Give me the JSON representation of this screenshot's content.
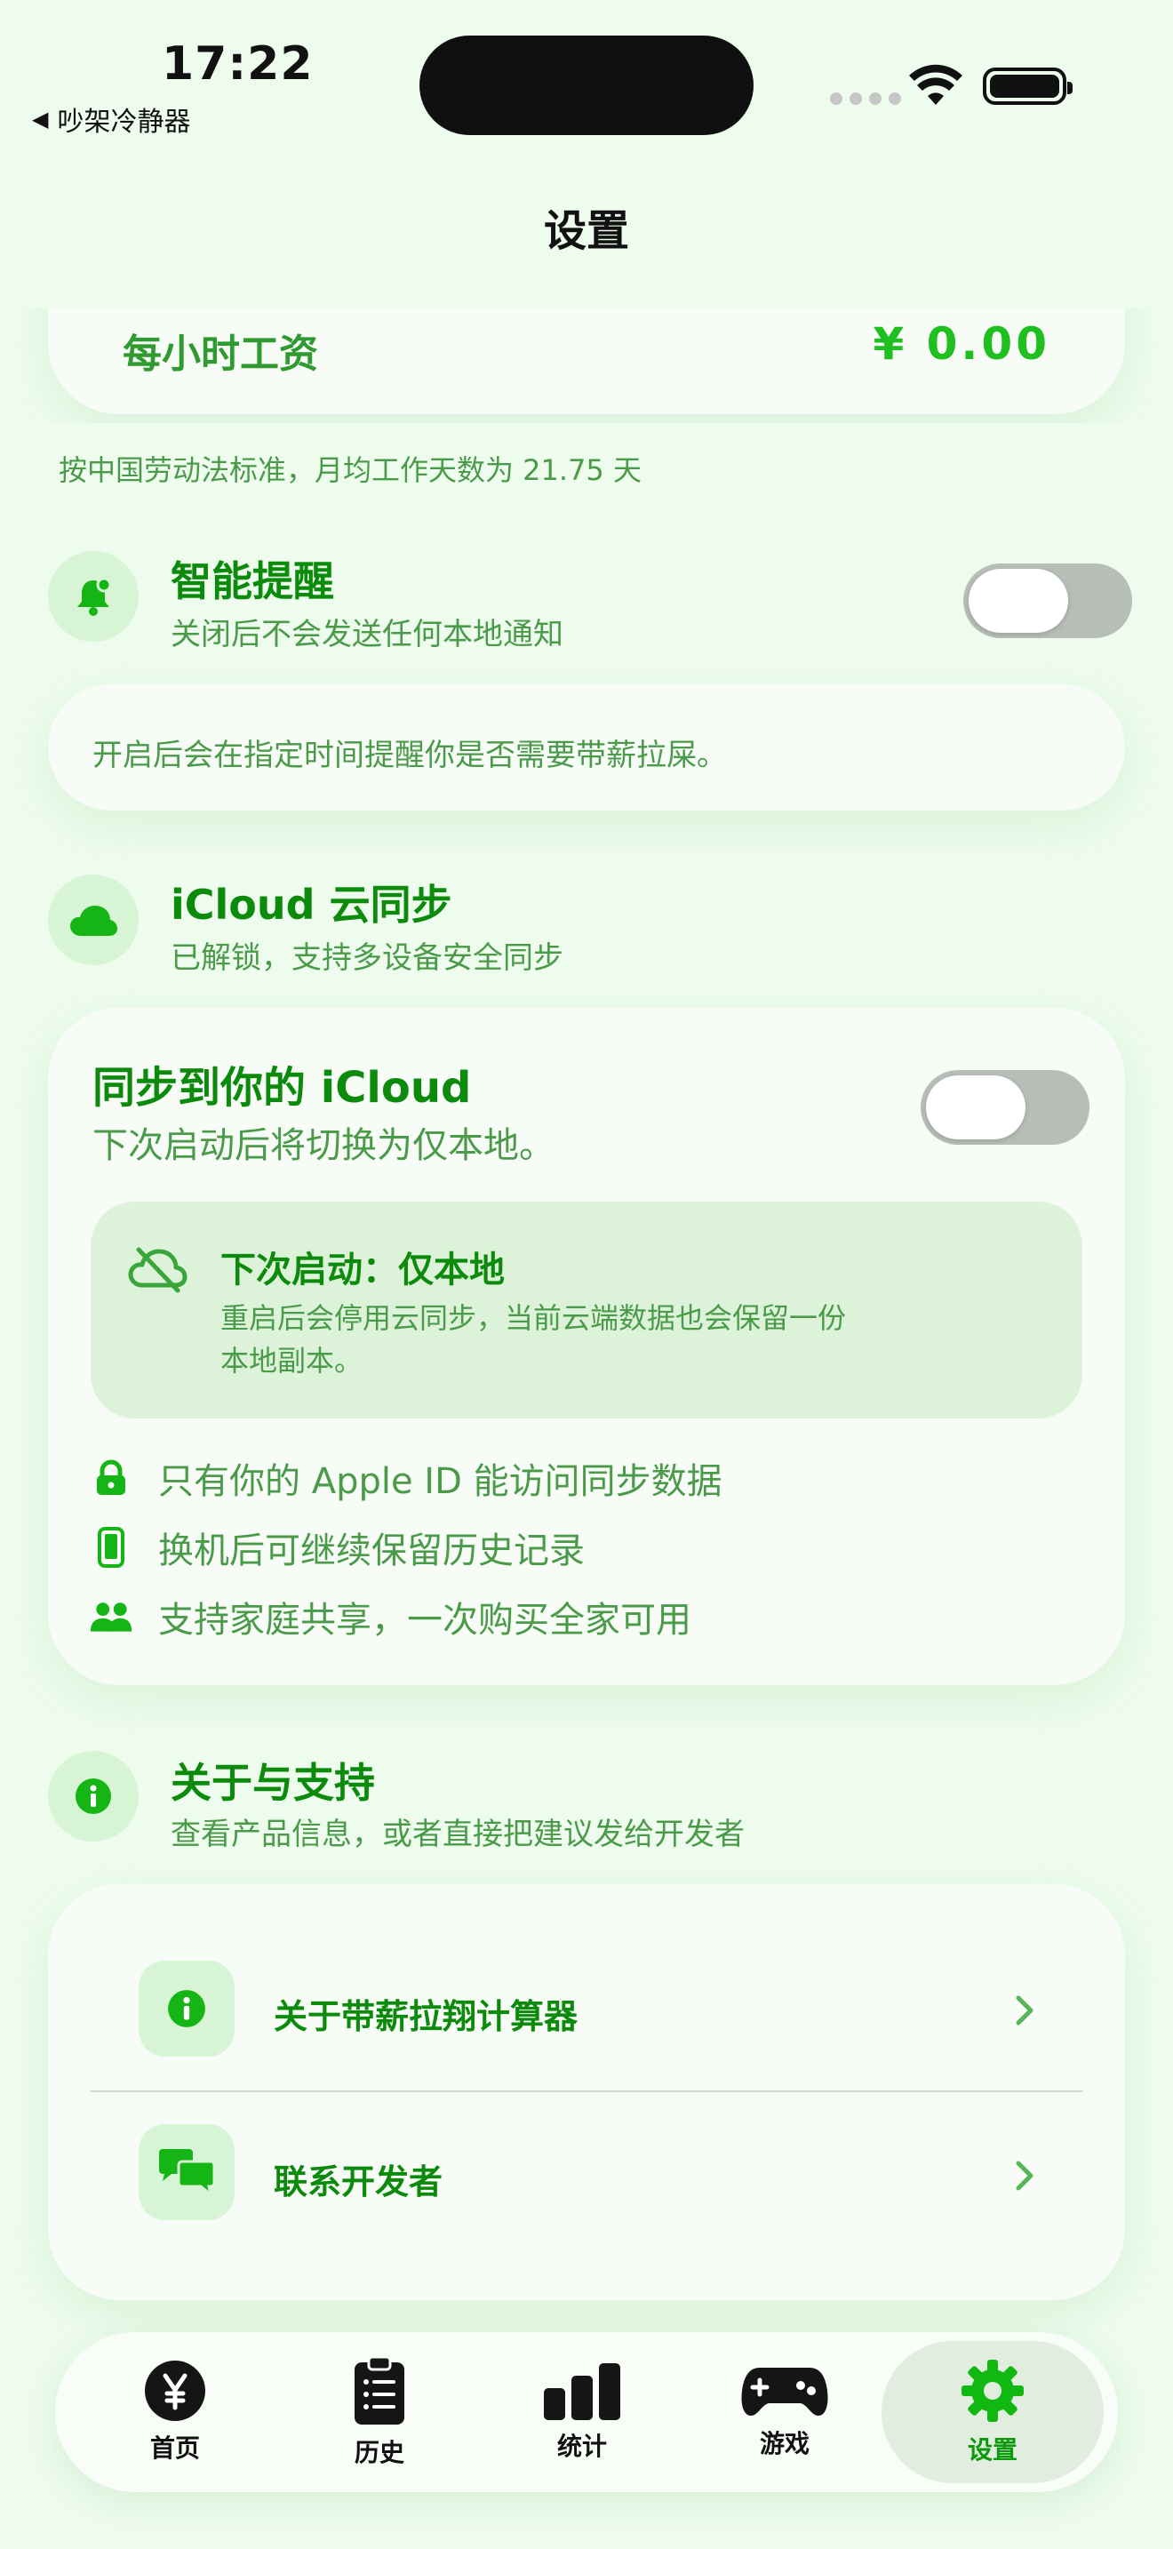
{
  "status_bar": {
    "time": "17:22",
    "back_app": "吵架冷静器"
  },
  "nav": {
    "title": "设置"
  },
  "wage_card": {
    "label": "每小时工资",
    "value": "¥ 0.00"
  },
  "wage_note": "按中国劳动法标准，月均工作天数为 21.75 天",
  "reminder": {
    "title": "智能提醒",
    "subtitle": "关闭后不会发送任何本地通知",
    "enabled": false,
    "card_text": "开启后会在指定时间提醒你是否需要带薪拉屎。"
  },
  "icloud": {
    "title": "iCloud 云同步",
    "subtitle": "已解锁，支持多设备安全同步",
    "sync_title": "同步到你的 iCloud",
    "sync_subtitle": "下次启动后将切换为仅本地。",
    "enabled": false,
    "notice_title": "下次启动：仅本地",
    "notice_body_line1": "重启后会停用云同步，当前云端数据也会保留一份",
    "notice_body_line2": "本地副本。",
    "features": [
      {
        "icon": "lock-icon",
        "text": "只有你的 Apple ID 能访问同步数据"
      },
      {
        "icon": "phone-icon",
        "text": "换机后可继续保留历史记录"
      },
      {
        "icon": "family-icon",
        "text": "支持家庭共享，一次购买全家可用"
      }
    ]
  },
  "about": {
    "title": "关于与支持",
    "subtitle": "查看产品信息，或者直接把建议发给开发者",
    "rows": [
      {
        "icon": "info-icon",
        "label": "关于带薪拉翔计算器"
      },
      {
        "icon": "chat-bubbles-icon",
        "label": "联系开发者"
      }
    ]
  },
  "tabbar": {
    "tabs": [
      {
        "icon": "yen-icon",
        "label": "首页"
      },
      {
        "icon": "clipboard-list-icon",
        "label": "历史"
      },
      {
        "icon": "bar-chart-icon",
        "label": "统计"
      },
      {
        "icon": "gamepad-icon",
        "label": "游戏"
      },
      {
        "icon": "gear-icon",
        "label": "设置"
      }
    ],
    "active": "设置"
  },
  "colors": {
    "accent": "#0c8a0c",
    "background": "#eefcee",
    "card": "#f7fcf6",
    "icon_bg": "#d7f5d5",
    "toggle_off": "#b7bdb7"
  }
}
